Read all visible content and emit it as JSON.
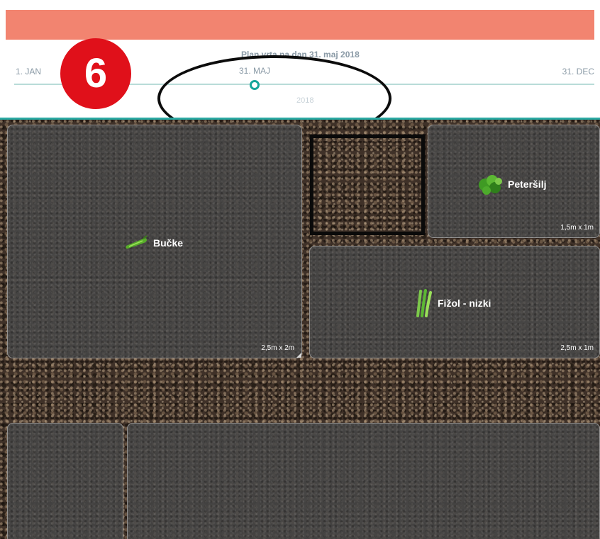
{
  "timeline": {
    "title": "Plan vrta na dan 31. maj 2018",
    "start_label": "1. JAN",
    "current_label": "31. MAJ",
    "end_label": "31. DEC",
    "faint_label": "2018",
    "position_fraction": 0.41
  },
  "badge": {
    "number": "6"
  },
  "beds": {
    "bucke": {
      "name": "Bučke",
      "size": "2,5m x 2m",
      "icon": "zucchini-icon"
    },
    "petersilj": {
      "name": "Peteršilj",
      "size": "1,5m x 1m",
      "icon": "parsley-icon"
    },
    "fizol": {
      "name": "Fižol - nizki",
      "size": "2,5m x 1m",
      "icon": "bean-icon"
    }
  },
  "colors": {
    "top_bar": "#f28470",
    "accent": "#2aa9a2",
    "badge": "#e0101a"
  }
}
